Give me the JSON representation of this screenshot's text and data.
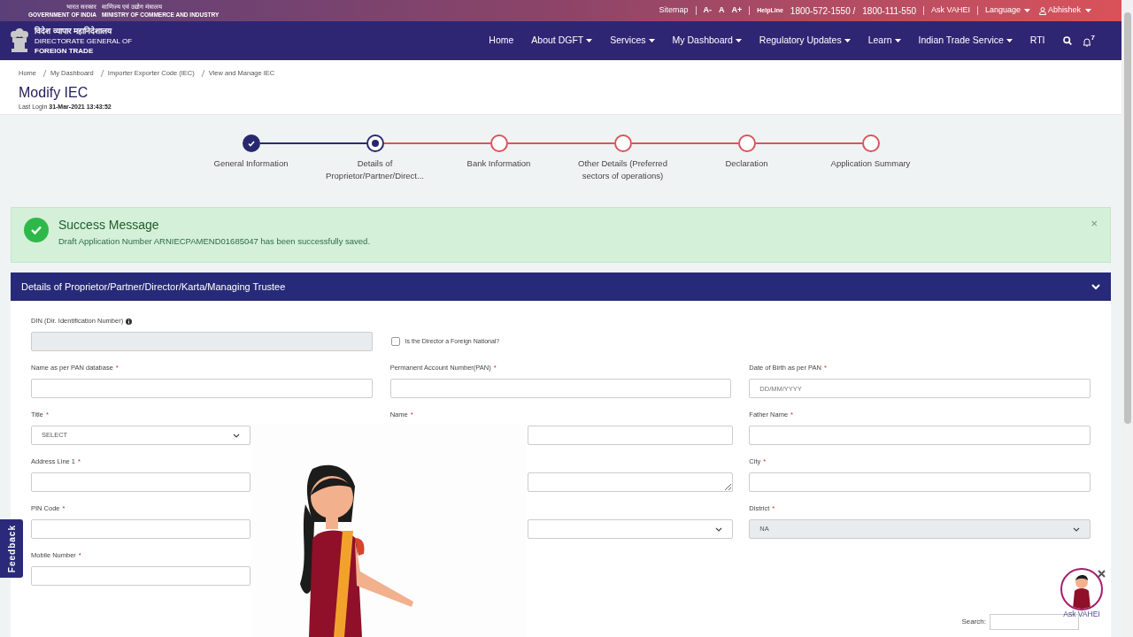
{
  "top_bar": {
    "gov_hindi": "भारत सरकार",
    "gov": "GOVERNMENT OF INDIA",
    "ministry_hindi": "वाणिज्य एवं उद्योग मंत्रालय",
    "ministry": "MINISTRY OF COMMERCE AND INDUSTRY",
    "links": [
      {
        "kind": "link",
        "label": "Sitemap"
      },
      {
        "kind": "font",
        "label": "A-"
      },
      {
        "kind": "font",
        "label": "A"
      },
      {
        "kind": "font",
        "label": "A+"
      },
      {
        "kind": "helpline",
        "label": "HelpLine",
        "numbers": [
          "1800-572-1550 /",
          "1800-111-550"
        ]
      },
      {
        "kind": "link",
        "label": "Ask VAHEI"
      },
      {
        "kind": "dropdown",
        "label": "Language"
      },
      {
        "kind": "user",
        "label": "Abhishek"
      }
    ]
  },
  "header": {
    "logo_hindi": "विदेश व्यापार महानिदेशालय",
    "logo_line_1": "DIRECTORATE GENERAL OF",
    "logo_line_2": "FOREIGN TRADE",
    "nav": [
      {
        "label": "Home",
        "dropdown": false
      },
      {
        "label": "About DGFT",
        "dropdown": true
      },
      {
        "label": "Services",
        "dropdown": true
      },
      {
        "label": "My Dashboard",
        "dropdown": true
      },
      {
        "label": "Regulatory Updates",
        "dropdown": true
      },
      {
        "label": "Learn",
        "dropdown": true
      },
      {
        "label": "Indian Trade Service",
        "dropdown": true
      },
      {
        "label": "RTI",
        "dropdown": false
      }
    ],
    "notification_count": "7"
  },
  "breadcrumb": [
    "Home",
    "My Dashboard",
    "Importer Exporter Code (IEC)",
    "View and Manage IEC"
  ],
  "page_title": "Modify IEC",
  "last_login_label": "Last Login",
  "last_login": "31-Mar-2021 13:43:52",
  "steps": [
    {
      "label": "General Information",
      "completed": true,
      "selected": false
    },
    {
      "label": "Details of Proprietor/Partner/Direct...",
      "completed": false,
      "selected": true
    },
    {
      "label": "Bank Information",
      "completed": false,
      "selected": false
    },
    {
      "label": "Other Details (Preferred sectors of operations)",
      "completed": false,
      "selected": false
    },
    {
      "label": "Declaration",
      "completed": false,
      "selected": false
    },
    {
      "label": "Application Summary",
      "completed": false,
      "selected": false
    }
  ],
  "alert": {
    "title": "Success Message",
    "message": "Draft Application Number ARNIECPAMEND01685047 has been successfully saved.",
    "close": "×"
  },
  "panel": {
    "title": "Details of Proprietor/Partner/Director/Karta/Managing Trustee",
    "expanded": true,
    "rows": [
      [
        {
          "kind": "input",
          "label": "DIN (Dir. Identification Number)",
          "info": true,
          "disabled": true
        },
        {
          "kind": "checkbox",
          "label": "Is the Director a Foreign National?",
          "checked": false
        }
      ],
      [
        {
          "kind": "input",
          "label": "Name as per PAN database",
          "required_mark": "*"
        },
        {
          "kind": "input",
          "label": "Permanent Account Number(PAN)",
          "required_mark": "*"
        },
        {
          "kind": "input",
          "label": "Date of Birth as per PAN",
          "required_mark": "*",
          "placeholder": "DD/MM/YYYY"
        }
      ],
      [
        {
          "kind": "select",
          "label": "Title",
          "required_mark": "*",
          "value": "SELECT"
        },
        {
          "kind": "input",
          "label": "Name",
          "required_mark": "*"
        },
        {
          "kind": "input",
          "label": "Father Name",
          "required_mark": "*"
        }
      ],
      [
        {
          "kind": "input",
          "label": "Address Line 1",
          "required_mark": "*"
        },
        {
          "kind": "textarea"
        },
        {
          "kind": "input",
          "label": "City",
          "required_mark": "*"
        }
      ],
      [
        {
          "kind": "input",
          "label": "PIN Code",
          "required_mark": "*"
        },
        {
          "kind": "select"
        },
        {
          "kind": "select",
          "label": "District",
          "required_mark": "*",
          "value": "NA",
          "disabled": true
        }
      ],
      [
        {
          "kind": "input",
          "label": "Mobile Number",
          "required_mark": "*"
        }
      ]
    ]
  },
  "feedback_tab": "Feedback",
  "assistant": {
    "label": "Ask VAHEI"
  },
  "search": {
    "label": "Search:"
  }
}
